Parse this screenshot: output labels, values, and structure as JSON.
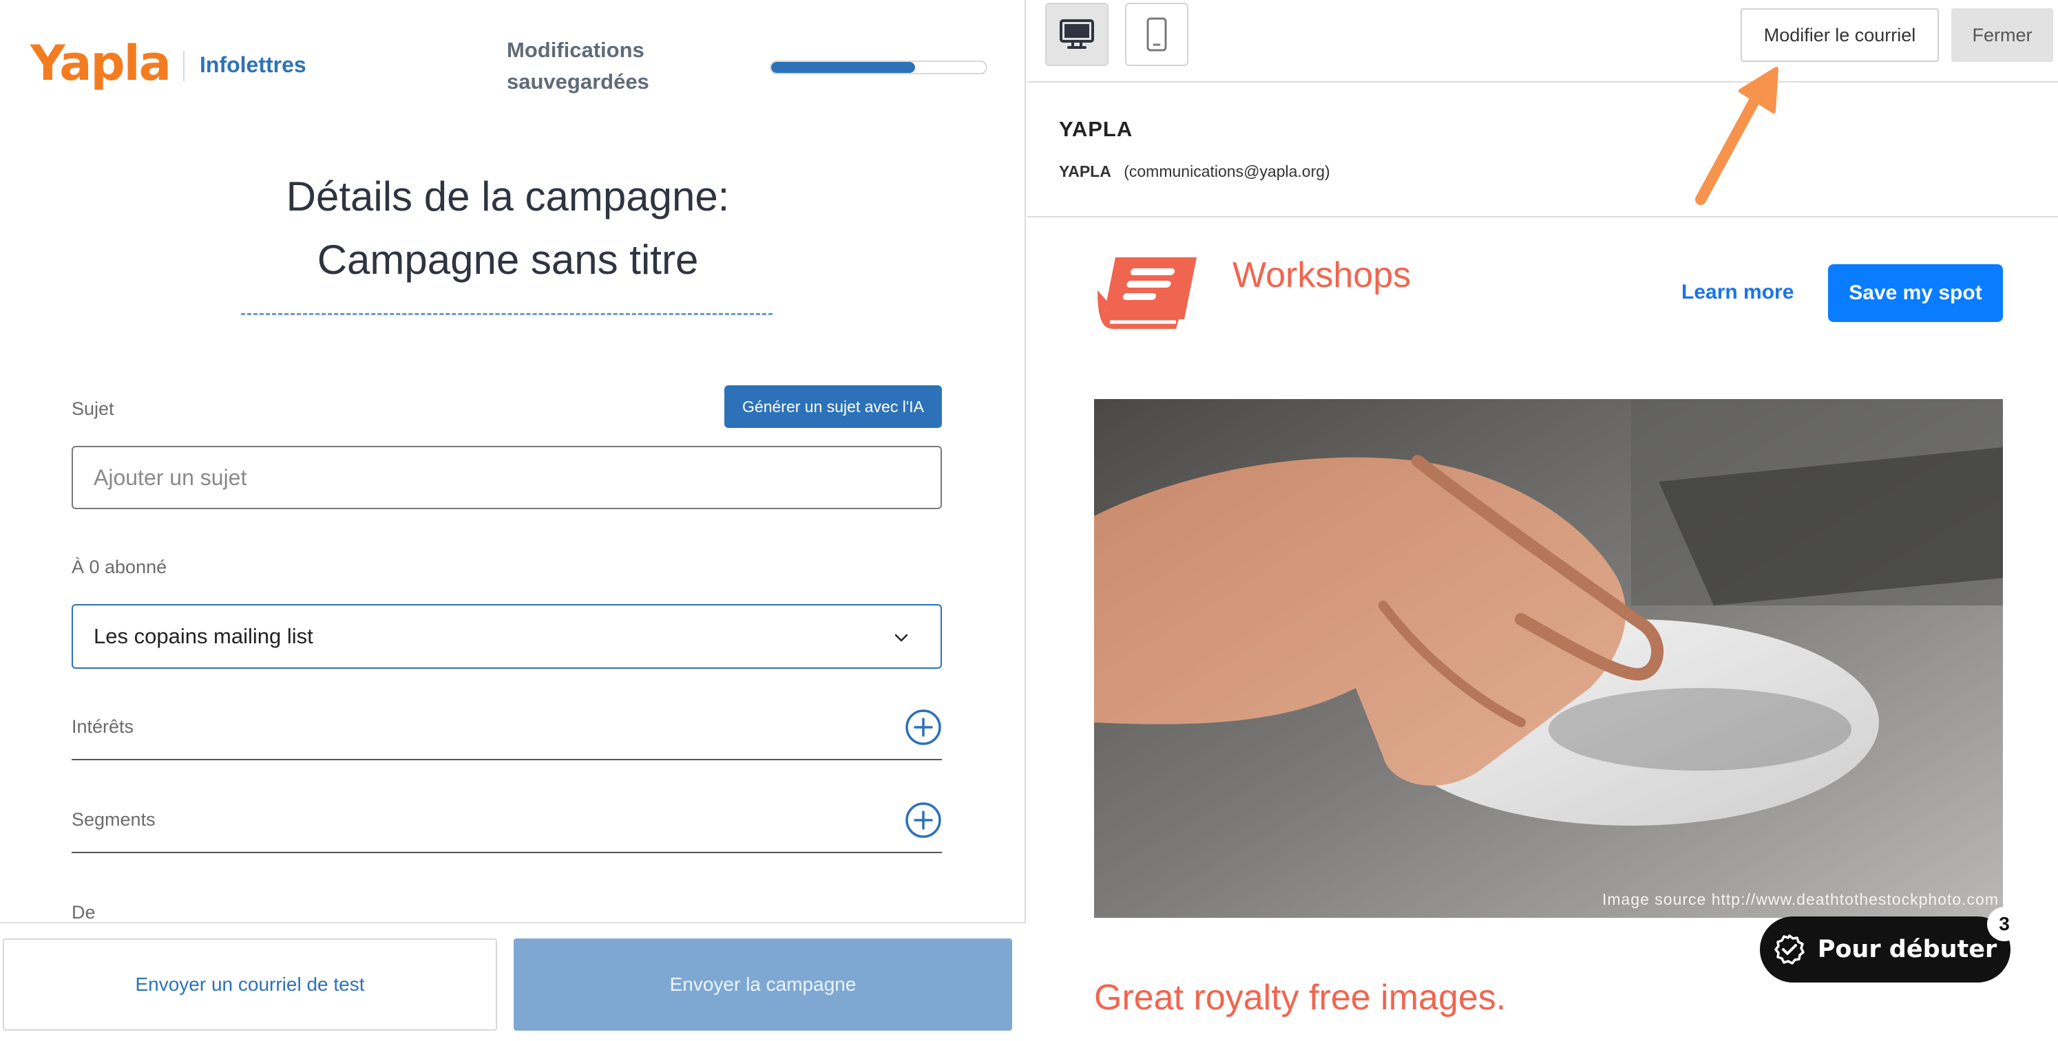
{
  "left": {
    "logo": "Yapla",
    "product": "Infolettres",
    "saved_status": "Modifications sauvegardées",
    "progress": 0.67,
    "title_line1": "Détails de la campagne:",
    "title_line2": "Campagne sans titre",
    "subject_label": "Sujet",
    "ai_button": "Générer un sujet avec l'IA",
    "subject_placeholder": "Ajouter un sujet",
    "audience_label": "À 0 abonné",
    "list_selected": "Les copains mailing list",
    "interests_label": "Intérêts",
    "segments_label": "Segments",
    "from_label": "De",
    "send_test_button": "Envoyer un courriel de test",
    "send_campaign_button": "Envoyer la campagne"
  },
  "right": {
    "icons": [
      "desktop-icon",
      "mobile-icon",
      "plus-circle-icon",
      "book-icon",
      "check-badge-icon"
    ],
    "edit_button": "Modifier le courriel",
    "close_button": "Fermer",
    "sender_name": "YAPLA",
    "sender_short": "YAPLA",
    "sender_email": "(communications@yapla.org)",
    "email": {
      "header_title": "Workshops",
      "learn_more": "Learn more",
      "save_spot": "Save my spot",
      "image_source": "Image source http://www.deathtothestockphoto.com",
      "headline": "Great royalty free images."
    },
    "start_button": "Pour débuter",
    "start_badge": "3"
  },
  "colors": {
    "brand_orange": "#f47c20",
    "primary_blue": "#2d72b8",
    "accent_red": "#f0654f",
    "cta_blue": "#0a7cff",
    "annotation_arrow": "#f7934c"
  }
}
